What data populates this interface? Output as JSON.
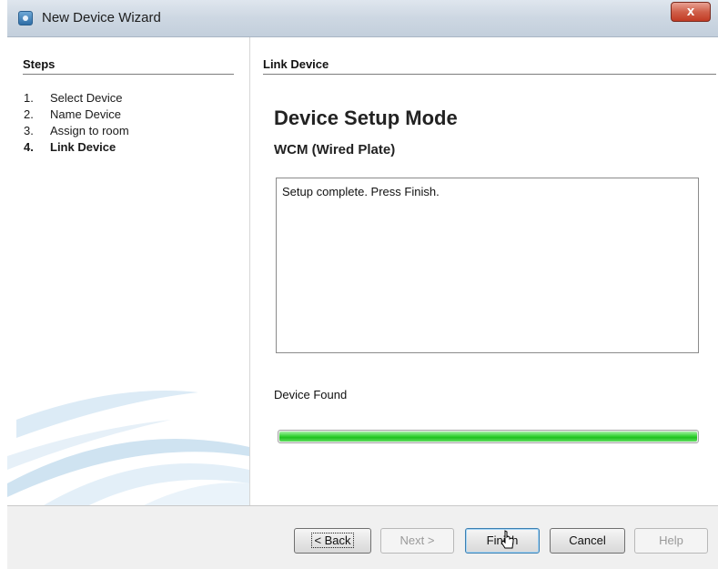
{
  "window": {
    "title": "New Device Wizard",
    "close_glyph": "x",
    "icon": "app-icon"
  },
  "steps": {
    "header": "Steps",
    "items": [
      {
        "num": "1.",
        "label": "Select Device",
        "active": false
      },
      {
        "num": "2.",
        "label": "Name Device",
        "active": false
      },
      {
        "num": "3.",
        "label": "Assign to room",
        "active": false
      },
      {
        "num": "4.",
        "label": "Link Device",
        "active": true
      }
    ]
  },
  "main": {
    "section_header": "Link Device",
    "title": "Device Setup Mode",
    "device_type": "WCM (Wired Plate)",
    "log_text": "Setup complete. Press Finish.",
    "status_label": "Device Found",
    "progress_fraction": 1.0,
    "progress_color": "#2ecc2e"
  },
  "buttons": {
    "back": "< Back",
    "next": "Next >",
    "finish": "Finish",
    "cancel": "Cancel",
    "help": "Help"
  },
  "colors": {
    "title_bar": "#cdd7e2",
    "close_button": "#c94a35",
    "progress": "#2ecc2e"
  }
}
